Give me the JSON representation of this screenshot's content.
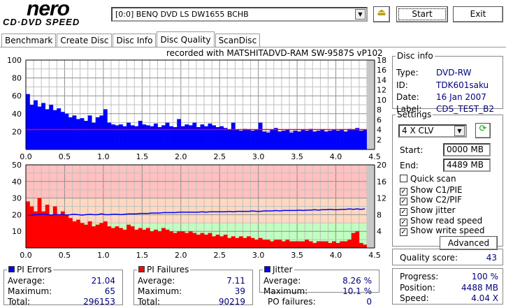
{
  "app": {
    "logo_top": "nero",
    "logo_bottom": "CD·DVD SPEED"
  },
  "toolbar": {
    "drive": "[0:0]  BENQ DVD LS DW1655 BCHB",
    "start_label": "Start",
    "exit_label": "Exit",
    "icon": "eject-icon"
  },
  "tabs": [
    {
      "label": "Benchmark"
    },
    {
      "label": "Create Disc"
    },
    {
      "label": "Disc Info"
    },
    {
      "label": "Disc Quality",
      "active": true
    },
    {
      "label": "ScanDisc"
    }
  ],
  "recorded_with": "recorded with MATSHITADVD-RAM SW-9587S vP102",
  "disc_info": {
    "title": "Disc info",
    "rows": [
      {
        "label": "Type:",
        "value": "DVD-RW"
      },
      {
        "label": "ID:",
        "value": "TDK601saku"
      },
      {
        "label": "Date:",
        "value": "16 Jan 2007"
      },
      {
        "label": "Label:",
        "value": "CDS_TEST_B2"
      }
    ]
  },
  "settings": {
    "title": "Settings",
    "speed": "4 X CLV",
    "start_label": "Start:",
    "start_value": "0000 MB",
    "end_label": "End:",
    "end_value": "4489 MB",
    "checks": [
      {
        "label": "Quick scan",
        "checked": false
      },
      {
        "label": "Show C1/PIE",
        "checked": true
      },
      {
        "label": "Show C2/PIF",
        "checked": true
      },
      {
        "label": "Show jitter",
        "checked": true
      },
      {
        "label": "Show read speed",
        "checked": true
      },
      {
        "label": "Show write speed",
        "checked": true
      }
    ],
    "advanced_label": "Advanced"
  },
  "quality": {
    "label": "Quality score:",
    "value": "43"
  },
  "progress": {
    "rows": [
      {
        "label": "Progress:",
        "value": "100 %"
      },
      {
        "label": "Position:",
        "value": "4488 MB"
      },
      {
        "label": "Speed:",
        "value": "4.04 X"
      }
    ]
  },
  "pi_errors": {
    "title": "PI Errors",
    "color": "#0000ff",
    "rows": [
      {
        "label": "Average:",
        "value": "21.04"
      },
      {
        "label": "Maximum:",
        "value": "65"
      },
      {
        "label": "Total:",
        "value": "296153"
      }
    ]
  },
  "pi_failures": {
    "title": "PI Failures",
    "color": "#ff0000",
    "rows": [
      {
        "label": "Average:",
        "value": "7.11"
      },
      {
        "label": "Maximum:",
        "value": "39"
      },
      {
        "label": "Total:",
        "value": "90219"
      }
    ]
  },
  "jitter": {
    "title": "Jitter",
    "color": "#0000ff",
    "rows": [
      {
        "label": "Average:",
        "value": "8.26 %"
      },
      {
        "label": "Maximum:",
        "value": "10.1 %"
      }
    ]
  },
  "po_failures": {
    "label": "PO failures:",
    "value": "0"
  },
  "chart_data": [
    {
      "type": "bar",
      "name": "PI Errors",
      "x_start": 0,
      "x_step": 0.05,
      "xlim": [
        0,
        4.5
      ],
      "ylim": [
        0,
        100
      ],
      "y2lim": [
        0,
        18
      ],
      "xticks": [
        "0.0",
        "0.5",
        "1.0",
        "1.5",
        "2.0",
        "2.5",
        "3.0",
        "3.5",
        "4.0",
        "4.5"
      ],
      "yticks": [
        "20",
        "40",
        "60",
        "80",
        "100"
      ],
      "y2ticks": [
        "2",
        "4",
        "6",
        "8",
        "10",
        "12",
        "14",
        "16",
        "18"
      ],
      "bar_color": "#0000ff",
      "line_color": "#ff0000",
      "grid": true,
      "values": [
        62,
        50,
        55,
        48,
        52,
        45,
        50,
        44,
        46,
        42,
        40,
        36,
        38,
        34,
        35,
        32,
        38,
        30,
        36,
        38,
        45,
        30,
        28,
        27,
        28,
        26,
        30,
        27,
        26,
        32,
        28,
        27,
        26,
        29,
        25,
        27,
        30,
        26,
        25,
        34,
        26,
        28,
        27,
        30,
        25,
        28,
        26,
        29,
        27,
        25,
        26,
        24,
        22,
        30,
        22,
        21,
        23,
        22,
        21,
        22,
        30,
        20,
        19,
        22,
        24,
        20,
        21,
        22,
        19,
        21,
        20,
        22,
        21,
        23,
        20,
        21,
        22,
        20,
        21,
        22,
        21,
        22,
        20,
        23,
        22,
        24,
        21,
        22
      ],
      "speed": 4.0
    },
    {
      "type": "bar",
      "name": "PI Failures",
      "x_start": 0,
      "x_step": 0.05,
      "xlim": [
        0,
        4.5
      ],
      "ylim": [
        0,
        50
      ],
      "y2lim": [
        0,
        20
      ],
      "xticks": [
        "0.0",
        "0.5",
        "1.0",
        "1.5",
        "2.0",
        "2.5",
        "3.0",
        "3.5",
        "4.0",
        "4.5"
      ],
      "yticks": [
        "10",
        "20",
        "30",
        "40",
        "50"
      ],
      "y2ticks": [
        "4",
        "8",
        "12",
        "16",
        "20"
      ],
      "bar_color": "#ff0000",
      "line_color": "#0000ff",
      "grid": true,
      "bands": [
        {
          "from": 0,
          "to": 6,
          "color": "#c0ffc0"
        },
        {
          "from": 6,
          "to": 12,
          "color": "#ffd8c0"
        },
        {
          "from": 12,
          "to": 20,
          "color": "#ffc0c0"
        }
      ],
      "values": [
        28,
        25,
        22,
        30,
        22,
        26,
        20,
        25,
        20,
        22,
        20,
        18,
        16,
        17,
        15,
        14,
        16,
        13,
        14,
        15,
        16,
        13,
        12,
        13,
        12,
        11,
        14,
        13,
        11,
        12,
        11,
        12,
        10,
        11,
        10,
        12,
        11,
        10,
        9,
        10,
        10,
        9,
        10,
        9,
        8,
        9,
        8,
        9,
        7,
        8,
        7,
        8,
        6,
        7,
        6,
        7,
        6,
        7,
        6,
        5,
        6,
        5,
        5,
        4,
        5,
        5,
        4,
        5,
        4,
        4,
        4,
        4,
        5,
        4,
        3,
        4,
        4,
        4,
        3,
        4,
        3,
        4,
        4,
        5,
        9,
        10,
        3,
        2
      ],
      "jitter": [
        7.8,
        7.9,
        8.0,
        8.0,
        8.1,
        8.0,
        7.9,
        8.0,
        8.0,
        8.0,
        7.9,
        8.0,
        8.1,
        8.0,
        7.9,
        8.0,
        8.1,
        8.0,
        8.0,
        8.2,
        8.0,
        8.0,
        8.1,
        8.1,
        8.0,
        8.1,
        8.2,
        8.2,
        8.2,
        8.3,
        8.3,
        8.3,
        8.4,
        8.4,
        8.4,
        8.5,
        8.5,
        8.5,
        8.5,
        8.6,
        8.6,
        8.6,
        8.6,
        8.6,
        8.6,
        8.7,
        8.6,
        8.7,
        8.7,
        8.7,
        8.7,
        8.7,
        8.8,
        8.7,
        8.8,
        8.8,
        8.8,
        8.8,
        8.9,
        8.8,
        8.8,
        8.9,
        8.9,
        8.9,
        9.0,
        8.9,
        9.0,
        9.0,
        9.0,
        9.0,
        9.1,
        9.0,
        9.1,
        9.1,
        9.2,
        9.1,
        9.2,
        9.2,
        9.3,
        9.2,
        9.2,
        9.3,
        9.3,
        9.4,
        9.3,
        9.4,
        9.3,
        9.4
      ]
    }
  ]
}
